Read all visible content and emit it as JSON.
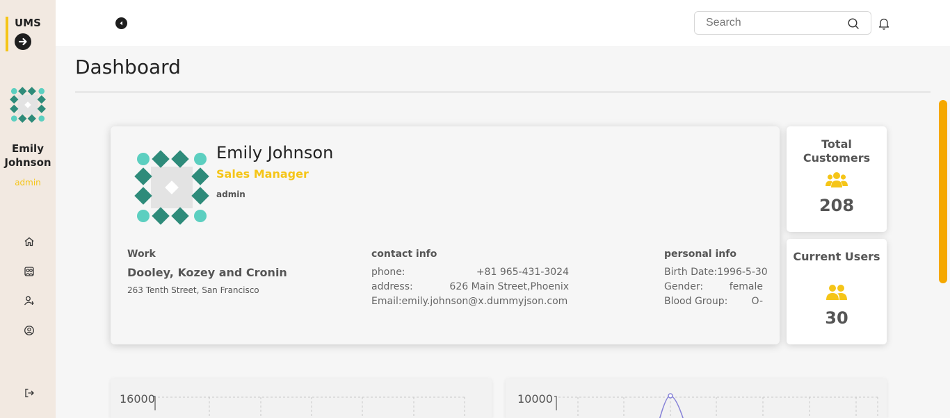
{
  "sidebar": {
    "brand": "UMS",
    "user_name": "Emily Johnson",
    "user_role": "admin",
    "nav": [
      "home-icon",
      "users-icon",
      "add-user-icon",
      "profile-icon",
      "logout-icon"
    ]
  },
  "topbar": {
    "search_placeholder": "Search"
  },
  "page": {
    "title": "Dashboard"
  },
  "profile": {
    "name": "Emily Johnson",
    "job_title": "Sales Manager",
    "role": "admin",
    "work": {
      "heading": "Work",
      "company": "Dooley, Kozey and Cronin",
      "address": "263 Tenth Street, San Francisco"
    },
    "contact": {
      "heading": "contact info",
      "phone_label": "phone:",
      "phone": "+81 965-431-3024",
      "address_label": "address:",
      "address": "626 Main Street,Phoenix",
      "email_line": "Email:emily.johnson@x.dummyjson.com"
    },
    "personal": {
      "heading": "personal info",
      "birth_line": "Birth Date:1996-5-30",
      "gender_label": "Gender:",
      "gender": "female",
      "blood_label": "Blood Group:",
      "blood": "O-"
    }
  },
  "stats": {
    "total_customers_label": "Total Customers",
    "total_customers": "208",
    "current_users_label": "Current Users",
    "current_users": "30"
  },
  "charts": {
    "left_top_tick": "16000",
    "right_top_tick": "10000"
  },
  "colors": {
    "accent": "#f5c518",
    "sidebar_bg": "#f2e9e1",
    "avatar_teal": "#2e8b7a",
    "avatar_mint": "#5ccfc0",
    "chart_line": "#8884d8"
  }
}
